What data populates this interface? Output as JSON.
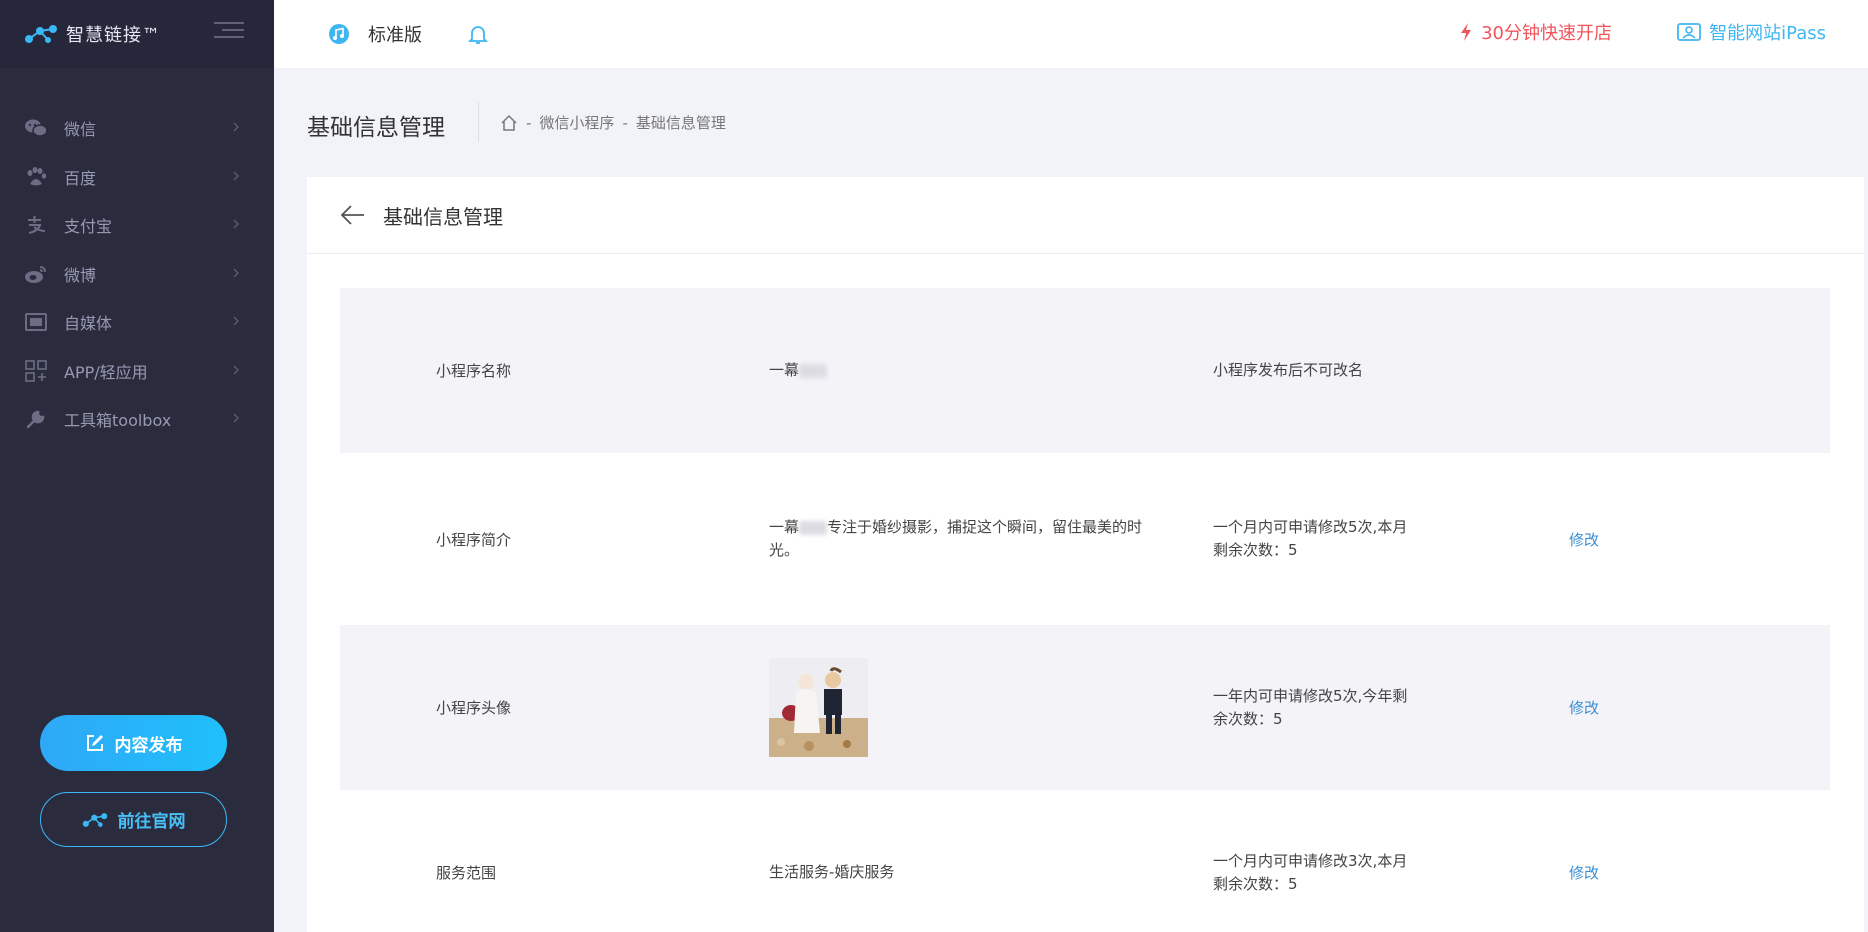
{
  "app": {
    "logo_text": "智慧链接™"
  },
  "sidebar": {
    "items": [
      {
        "label": "微信",
        "icon": "wechat-icon"
      },
      {
        "label": "百度",
        "icon": "baidu-paw-icon"
      },
      {
        "label": "支付宝",
        "icon": "alipay-icon"
      },
      {
        "label": "微博",
        "icon": "weibo-icon"
      },
      {
        "label": "自媒体",
        "icon": "media-icon"
      },
      {
        "label": "APP/轻应用",
        "icon": "app-grid-icon"
      },
      {
        "label": "工具箱toolbox",
        "icon": "wrench-icon"
      }
    ],
    "publish_button": "内容发布",
    "site_button": "前往官网"
  },
  "header": {
    "edition": "标准版",
    "promo": "30分钟快速开店",
    "ipass": "智能网站iPass"
  },
  "page": {
    "title": "基础信息管理",
    "breadcrumb": [
      "微信小程序",
      "基础信息管理"
    ]
  },
  "card": {
    "title": "基础信息管理",
    "rows": [
      {
        "label": "小程序名称",
        "value": "一幕",
        "note": "小程序发布后不可改名",
        "action": ""
      },
      {
        "label": "小程序简介",
        "value_prefix": "一幕",
        "value_suffix": "专注于婚纱摄影，捕捉这个瞬间，留住最美的时光。",
        "note": "一个月内可申请修改5次,本月剩余次数：5",
        "action": "修改"
      },
      {
        "label": "小程序头像",
        "note": "一年内可申请修改5次,今年剩余次数：5",
        "action": "修改"
      },
      {
        "label": "服务范围",
        "value": "生活服务-婚庆服务",
        "note": "一个月内可申请修改3次,本月剩余次数：5",
        "action": "修改"
      }
    ]
  },
  "colors": {
    "sidebar_bg": "#2a2b3d",
    "accent_blue": "#2fa8f6",
    "promo_red": "#f0555b",
    "link_blue": "#3a8fd5"
  }
}
